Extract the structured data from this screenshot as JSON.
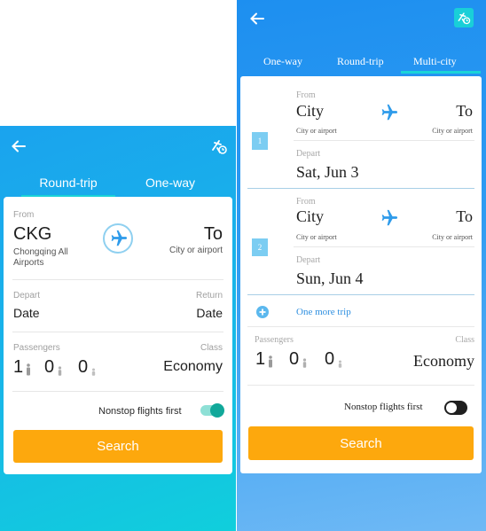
{
  "left_screen": {
    "tabs": [
      "Round-trip",
      "One-way"
    ],
    "from_label": "From",
    "from_code": "CKG",
    "from_city": "Chongqing All Airports",
    "to_value": "To",
    "to_sub": "City or airport",
    "depart_label": "Depart",
    "depart_value": "Date",
    "return_label": "Return",
    "return_value": "Date",
    "passengers_label": "Passengers",
    "class_label": "Class",
    "adults": "1",
    "children": "0",
    "infants": "0",
    "class_value": "Economy",
    "nonstop_label": "Nonstop flights first",
    "nonstop_on": true,
    "search_label": "Search"
  },
  "right_screen": {
    "tabs": [
      "One-way",
      "Round-trip",
      "Multi-city"
    ],
    "trips": [
      {
        "number": "1",
        "from_label": "From",
        "from_value": "City",
        "from_sub": "City or airport",
        "to_value": "To",
        "to_sub": "City or airport",
        "depart_label": "Depart",
        "depart_value": "Sat, Jun 3"
      },
      {
        "number": "2",
        "from_label": "From",
        "from_value": "City",
        "from_sub": "City or airport",
        "to_value": "To",
        "to_sub": "City or airport",
        "depart_label": "Depart",
        "depart_value": "Sun, Jun 4"
      }
    ],
    "add_trip_label": "One more trip",
    "passengers_label": "Passengers",
    "class_label": "Class",
    "adults": "1",
    "children": "0",
    "infants": "0",
    "class_value": "Economy",
    "nonstop_label": "Nonstop flights first",
    "nonstop_on": false,
    "search_label": "Search"
  },
  "colors": {
    "accent_orange": "#fda80d",
    "teal": "#19d2d7",
    "plane_blue": "#2e9bea"
  }
}
